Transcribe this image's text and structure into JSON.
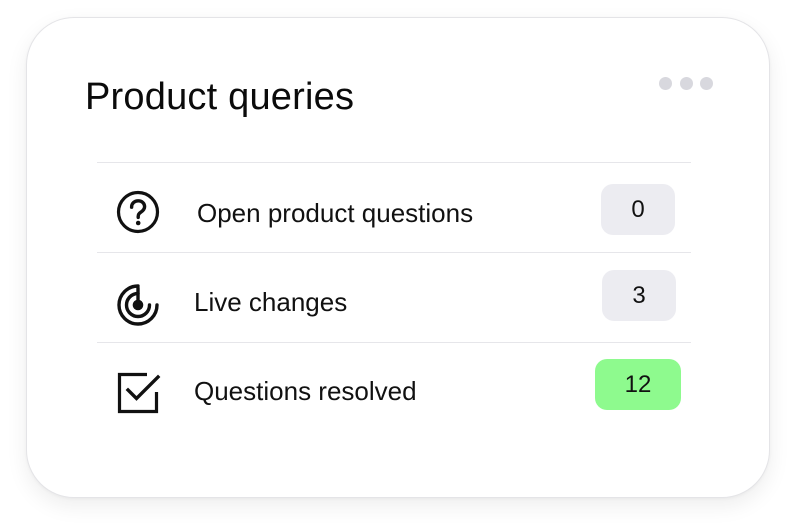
{
  "card": {
    "title": "Product queries",
    "menu_icon": "more-horizontal-icon"
  },
  "rows": [
    {
      "icon": "help-circle-icon",
      "label": "Open product questions",
      "count": "0",
      "badge_color": "#ececf1"
    },
    {
      "icon": "live-radar-icon",
      "label": "Live changes",
      "count": "3",
      "badge_color": "#ececf1"
    },
    {
      "icon": "checkbox-checked-icon",
      "label": "Questions resolved",
      "count": "12",
      "badge_color": "#8efa8e"
    }
  ]
}
